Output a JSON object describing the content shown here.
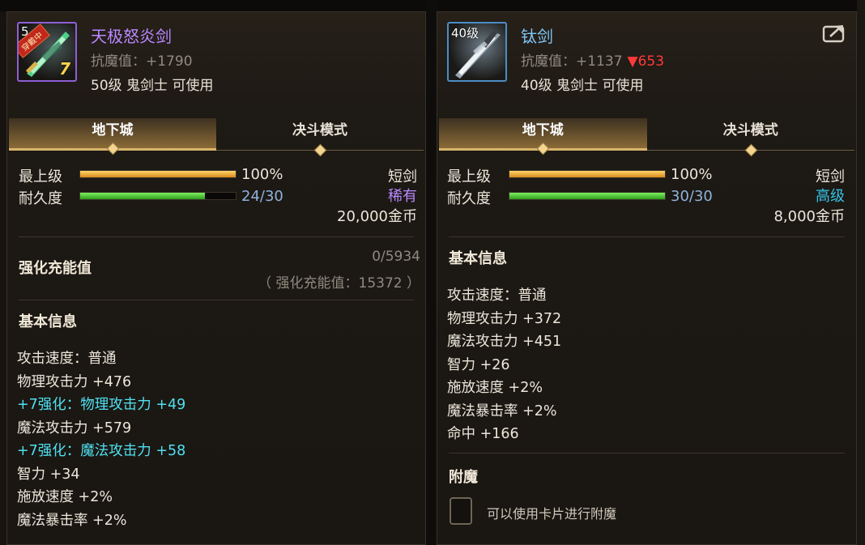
{
  "left": {
    "level_badge": "5",
    "equipped_badge": "穿戴中",
    "enhance_badge": "7",
    "name": "天极怒炎剑",
    "resist": "抗魔值：+1790",
    "requirement": "50级 鬼剑士 可使用",
    "tabs": [
      "地下城",
      "决斗模式"
    ],
    "stats": {
      "max_label": "最上级",
      "max_value": "100%",
      "max_fill": 1.0,
      "durability_label": "耐久度",
      "durability_value": "24/30",
      "durability_fill": 0.8,
      "weapon_type": "短剑",
      "rarity": "稀有",
      "price": "20,000金币"
    },
    "charge": {
      "title": "强化充能值",
      "progress": "0/5934",
      "total": "（ 强化充能值：15372 ）"
    },
    "basic_title": "基本信息",
    "lines": [
      {
        "text": "攻击速度：普通",
        "style": "normal"
      },
      {
        "text": "物理攻击力 +476",
        "style": "normal"
      },
      {
        "text": "+7强化：物理攻击力 +49",
        "style": "cyan"
      },
      {
        "text": "魔法攻击力 +579",
        "style": "normal"
      },
      {
        "text": "+7强化：魔法攻击力 +58",
        "style": "cyan"
      },
      {
        "text": "智力 +34",
        "style": "normal"
      },
      {
        "text": "施放速度 +2%",
        "style": "normal"
      },
      {
        "text": "魔法暴击率 +2%",
        "style": "normal"
      }
    ]
  },
  "right": {
    "level_badge": "40级",
    "name": "钛剑",
    "resist": "抗魔值：+1137",
    "resist_drop": "▼653",
    "requirement": "40级 鬼剑士 可使用",
    "tabs": [
      "地下城",
      "决斗模式"
    ],
    "stats": {
      "max_label": "最上级",
      "max_value": "100%",
      "max_fill": 1.0,
      "durability_label": "耐久度",
      "durability_value": "30/30",
      "durability_fill": 1.0,
      "weapon_type": "短剑",
      "rarity": "高级",
      "price": "8,000金币"
    },
    "basic_title": "基本信息",
    "lines": [
      {
        "text": "攻击速度：普通",
        "style": "normal"
      },
      {
        "text": "物理攻击力 +372",
        "style": "normal"
      },
      {
        "text": "魔法攻击力 +451",
        "style": "normal"
      },
      {
        "text": "智力 +26",
        "style": "normal"
      },
      {
        "text": "施放速度 +2%",
        "style": "normal"
      },
      {
        "text": "魔法暴击率 +2%",
        "style": "normal"
      },
      {
        "text": "命中 +166",
        "style": "normal"
      }
    ],
    "enchant_title": "附魔",
    "enchant_hint": "可以使用卡片进行附魔"
  },
  "colors": {
    "epic_name": "#b988ff",
    "rare_name": "#7fc5f5",
    "enhance_text": "#4fe0f0",
    "drop_red": "#ff3a3a",
    "tab_gold": "#d8b56c"
  }
}
